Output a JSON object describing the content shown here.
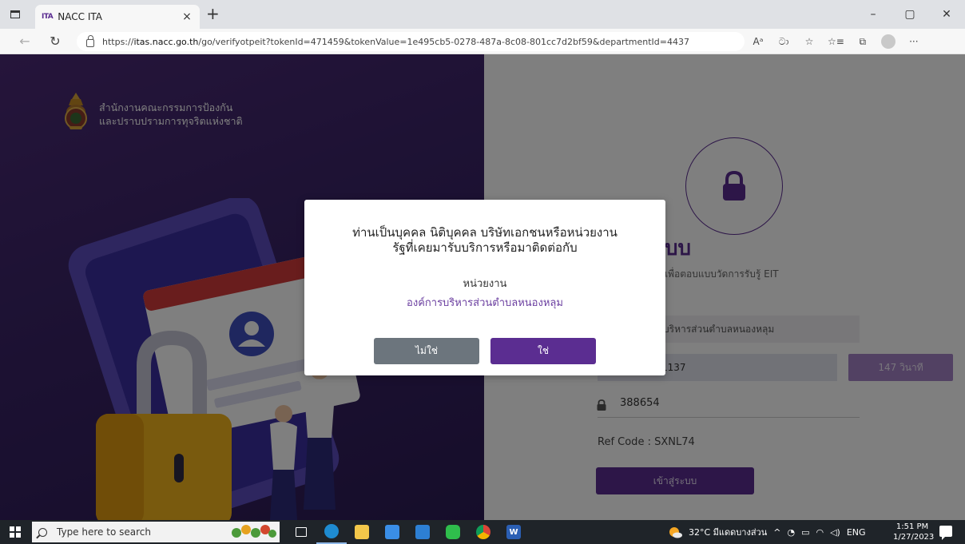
{
  "browser": {
    "tab_favicon_text": "ITA",
    "tab_title": "NACC ITA",
    "tab_close": "×",
    "new_tab": "+",
    "window_minimize": "–",
    "window_restore": "▢",
    "window_close": "✕",
    "url_prefix": "https://",
    "url_host": "itas.nacc.go.th",
    "url_path": "/go/verifyotpeit?tokenId=471459&tokenValue=1e495cb5-0278-487a-8c08-801cc7d2bf59&departmentId=4437",
    "read_aloud": "Aᵃ",
    "translate": "ටා"
  },
  "left_panel": {
    "org_name_line1": "สำนักงานคณะกรรมการป้องกัน",
    "org_name_line2": "และปราบปรามการทุจริตแห่งชาติ"
  },
  "right_panel": {
    "heading": "บบ",
    "subtitle": "เพื่อตอบแบบวัดการรับรู้ EIT",
    "department_field": "บริหารส่วนตำบลหนองหลุม",
    "phone_field": "1137",
    "timer_button": "147 วินาที",
    "otp_value": "388654",
    "ref_code": "Ref Code : SXNL74",
    "login_button": "เข้าสู่ระบบ"
  },
  "modal": {
    "question_line1": "ท่านเป็นบุคคล นิติบุคคล บริษัทเอกชนหรือหน่วยงาน",
    "question_line2": "รัฐที่เคยมารับบริการหรือมาติดต่อกับ",
    "department_label": "หน่วยงาน",
    "department_name": "องค์การบริหารส่วนตำบลหนองหลุม",
    "no_button": "ไม่ใช่",
    "yes_button": "ใช่"
  },
  "taskbar": {
    "search_placeholder": "Type here to search",
    "weather_text": "32°C มีแดดบางส่วน",
    "language": "ENG",
    "time": "1:51 PM",
    "date": "1/27/2023"
  },
  "colors": {
    "brand_purple": "#5b2d91",
    "timer_purple": "#a482c6",
    "no_gray": "#6c757d"
  }
}
